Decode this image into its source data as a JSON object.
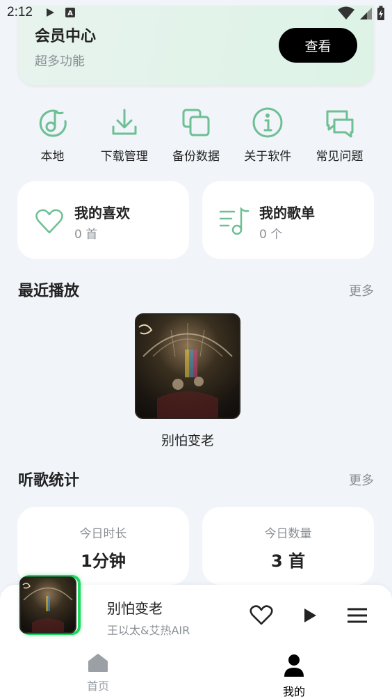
{
  "status_bar": {
    "time": "2:12",
    "icons": [
      "play-icon",
      "a-icon",
      "wifi-icon",
      "signal-icon",
      "battery-charging-icon"
    ]
  },
  "member": {
    "title": "会员中心",
    "subtitle": "超多功能",
    "button": "查看"
  },
  "actions": [
    {
      "label": "本地",
      "icon": "local-music-icon"
    },
    {
      "label": "下载管理",
      "icon": "download-icon"
    },
    {
      "label": "备份数据",
      "icon": "backup-icon"
    },
    {
      "label": "关于软件",
      "icon": "info-icon"
    },
    {
      "label": "常见问题",
      "icon": "faq-icon"
    }
  ],
  "favorites": {
    "title": "我的喜欢",
    "count": "0 首"
  },
  "playlists": {
    "title": "我的歌单",
    "count": "0 个"
  },
  "recent": {
    "title": "最近播放",
    "more": "更多",
    "items": [
      {
        "title": "别怕变老"
      }
    ]
  },
  "stats": {
    "title": "听歌统计",
    "more": "更多",
    "today_duration": {
      "label": "今日时长",
      "value": "1分钟"
    },
    "today_count": {
      "label": "今日数量",
      "value": "3 首"
    }
  },
  "player": {
    "title": "别怕变老",
    "artist": "王以太&艾热AIR"
  },
  "nav": {
    "home": "首页",
    "mine": "我的",
    "active_color": "#000000",
    "inactive_color": "#9aa0a6"
  },
  "accent_color": "#6dbf94"
}
